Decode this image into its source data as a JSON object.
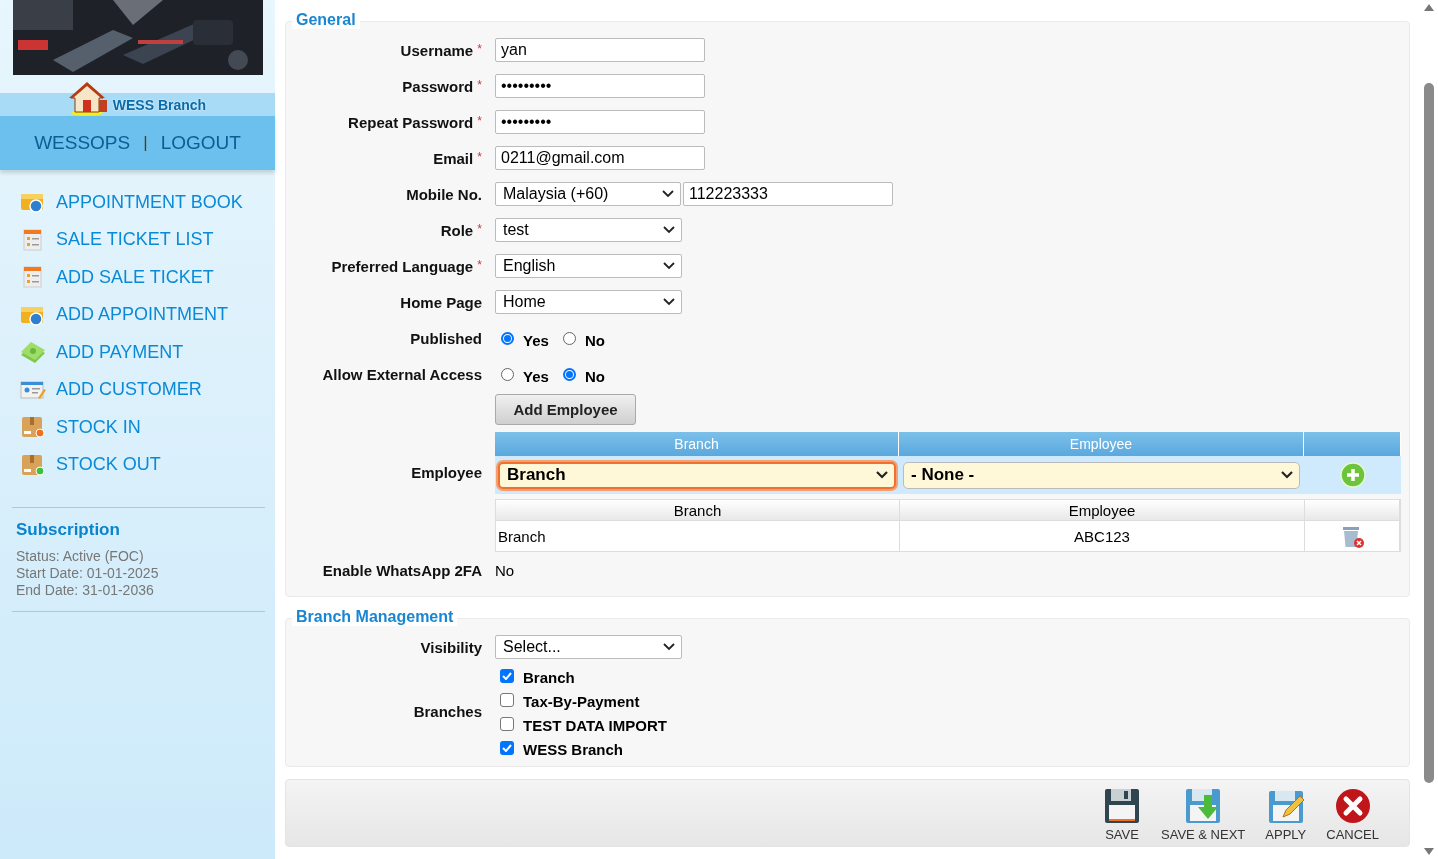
{
  "sidebar": {
    "branch_name": "WESS Branch",
    "links": [
      {
        "label": "WESSOPS"
      },
      {
        "label": "LOGOUT"
      }
    ],
    "link_separator": "|",
    "menu": [
      {
        "label": "APPOINTMENT BOOK",
        "kind": "calendar"
      },
      {
        "label": "SALE TICKET LIST",
        "kind": "ticket"
      },
      {
        "label": "ADD SALE TICKET",
        "kind": "ticket"
      },
      {
        "label": "ADD APPOINTMENT",
        "kind": "calendar"
      },
      {
        "label": "ADD PAYMENT",
        "kind": "payment"
      },
      {
        "label": "ADD CUSTOMER",
        "kind": "customer"
      },
      {
        "label": "STOCK IN",
        "kind": "stock_in"
      },
      {
        "label": "STOCK OUT",
        "kind": "stock_out"
      }
    ],
    "subscription": {
      "title": "Subscription",
      "lines": [
        "Status: Active (FOC)",
        "Start Date: 01-01-2025",
        "End Date: 31-01-2036"
      ]
    }
  },
  "general": {
    "legend": "General",
    "fields": [
      {
        "kind": "text",
        "label": "Username",
        "mark": "*",
        "value": "yan"
      },
      {
        "kind": "text",
        "label": "Password",
        "mark": "*",
        "value": "•••••••••"
      },
      {
        "kind": "text",
        "label": "Repeat Password",
        "mark": "*",
        "value": "•••••••••"
      },
      {
        "kind": "text",
        "label": "Email",
        "mark": "*",
        "value": "0211@gmail.com"
      },
      {
        "kind": "phone",
        "label": "Mobile No.",
        "country": "Malaysia (+60)",
        "value": "112223333"
      },
      {
        "kind": "select",
        "label": "Role",
        "mark": "*",
        "value": "test"
      },
      {
        "kind": "select",
        "label": "Preferred Language",
        "mark": "*",
        "value": "English"
      },
      {
        "kind": "select",
        "label": "Home Page",
        "value": "Home"
      },
      {
        "kind": "radio",
        "label": "Published",
        "options": [
          {
            "label": "Yes",
            "selected": true
          },
          {
            "label": "No",
            "selected": false
          }
        ]
      },
      {
        "kind": "radio",
        "label": "Allow External Access",
        "options": [
          {
            "label": "Yes",
            "selected": false
          },
          {
            "label": "No",
            "selected": true
          }
        ]
      },
      {
        "kind": "employee",
        "label": "Employee",
        "add_button": "Add Employee",
        "entry_columns": [
          "Branch",
          "Employee"
        ],
        "branch_select": {
          "value": "Branch",
          "focused": true
        },
        "employee_select": {
          "value": "- None -",
          "focused": false
        },
        "list_columns": [
          "Branch",
          "Employee"
        ],
        "rows": [
          {
            "branch": "Branch",
            "employee": "ABC123"
          }
        ]
      },
      {
        "kind": "static",
        "label": "Enable WhatsApp 2FA",
        "value": "No"
      }
    ]
  },
  "branch_management": {
    "legend": "Branch Management",
    "fields": [
      {
        "kind": "select",
        "label": "Visibility",
        "value": "Select..."
      },
      {
        "kind": "checkbox",
        "label": "Branches",
        "options": [
          {
            "label": "Branch",
            "checked": true
          },
          {
            "label": "Tax-By-Payment",
            "checked": false
          },
          {
            "label": "TEST DATA IMPORT",
            "checked": false
          },
          {
            "label": "WESS Branch",
            "checked": true
          }
        ]
      }
    ]
  },
  "actions": [
    {
      "label": "SAVE",
      "kind": "save"
    },
    {
      "label": "SAVE & NEXT",
      "kind": "save_next"
    },
    {
      "label": "APPLY",
      "kind": "apply"
    },
    {
      "label": "CANCEL",
      "kind": "cancel"
    }
  ]
}
